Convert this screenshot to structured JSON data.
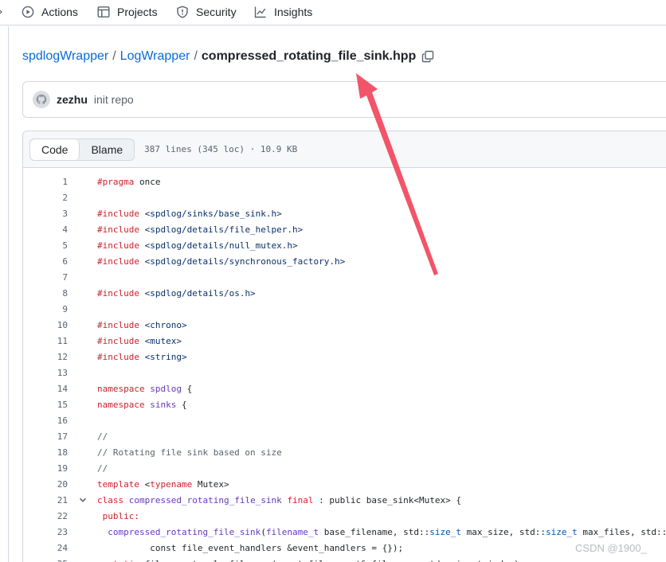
{
  "nav": {
    "items": [
      {
        "label": "Actions",
        "icon": "play-circle-icon"
      },
      {
        "label": "Projects",
        "icon": "table-icon"
      },
      {
        "label": "Security",
        "icon": "shield-icon"
      },
      {
        "label": "Insights",
        "icon": "graph-icon"
      }
    ]
  },
  "breadcrumb": {
    "repo": "spdlogWrapper",
    "folder": "LogWrapper",
    "separator": "/",
    "file": "compressed_rotating_file_sink.hpp"
  },
  "commit": {
    "author": "zezhu",
    "message": "init repo"
  },
  "file": {
    "tabs": [
      "Code",
      "Blame"
    ],
    "active_tab": "Code",
    "meta": "387 lines (345 loc) · 10.9 KB"
  },
  "code": {
    "lines": [
      {
        "n": "1",
        "tokens": [
          [
            "kw",
            "#pragma"
          ],
          [
            "pl",
            " once"
          ]
        ]
      },
      {
        "n": "2",
        "tokens": []
      },
      {
        "n": "3",
        "tokens": [
          [
            "kw",
            "#include"
          ],
          [
            "pl",
            " "
          ],
          [
            "str",
            "<spdlog/sinks/base_sink.h>"
          ]
        ]
      },
      {
        "n": "4",
        "tokens": [
          [
            "kw",
            "#include"
          ],
          [
            "pl",
            " "
          ],
          [
            "str",
            "<spdlog/details/file_helper.h>"
          ]
        ]
      },
      {
        "n": "5",
        "tokens": [
          [
            "kw",
            "#include"
          ],
          [
            "pl",
            " "
          ],
          [
            "str",
            "<spdlog/details/null_mutex.h>"
          ]
        ]
      },
      {
        "n": "6",
        "tokens": [
          [
            "kw",
            "#include"
          ],
          [
            "pl",
            " "
          ],
          [
            "str",
            "<spdlog/details/synchronous_factory.h>"
          ]
        ]
      },
      {
        "n": "7",
        "tokens": []
      },
      {
        "n": "8",
        "tokens": [
          [
            "kw",
            "#include"
          ],
          [
            "pl",
            " "
          ],
          [
            "str",
            "<spdlog/details/os.h>"
          ]
        ]
      },
      {
        "n": "9",
        "tokens": []
      },
      {
        "n": "10",
        "tokens": [
          [
            "kw",
            "#include"
          ],
          [
            "pl",
            " "
          ],
          [
            "str",
            "<chrono>"
          ]
        ]
      },
      {
        "n": "11",
        "tokens": [
          [
            "kw",
            "#include"
          ],
          [
            "pl",
            " "
          ],
          [
            "str",
            "<mutex>"
          ]
        ]
      },
      {
        "n": "12",
        "tokens": [
          [
            "kw",
            "#include"
          ],
          [
            "pl",
            " "
          ],
          [
            "str",
            "<string>"
          ]
        ]
      },
      {
        "n": "13",
        "tokens": []
      },
      {
        "n": "14",
        "tokens": [
          [
            "kw",
            "namespace"
          ],
          [
            "pl",
            " "
          ],
          [
            "ent",
            "spdlog"
          ],
          [
            "pl",
            " {"
          ]
        ]
      },
      {
        "n": "15",
        "tokens": [
          [
            "kw",
            "namespace"
          ],
          [
            "pl",
            " "
          ],
          [
            "ent",
            "sinks"
          ],
          [
            "pl",
            " {"
          ]
        ]
      },
      {
        "n": "16",
        "tokens": []
      },
      {
        "n": "17",
        "tokens": [
          [
            "com",
            "//"
          ]
        ]
      },
      {
        "n": "18",
        "tokens": [
          [
            "com",
            "// Rotating file sink based on size"
          ]
        ]
      },
      {
        "n": "19",
        "tokens": [
          [
            "com",
            "//"
          ]
        ]
      },
      {
        "n": "20",
        "tokens": [
          [
            "kw",
            "template"
          ],
          [
            "pl",
            " <"
          ],
          [
            "kw",
            "typename"
          ],
          [
            "pl",
            " Mutex>"
          ]
        ]
      },
      {
        "n": "21",
        "fold": true,
        "tokens": [
          [
            "kw",
            "class"
          ],
          [
            "pl",
            " "
          ],
          [
            "ent",
            "compressed_rotating_file_sink"
          ],
          [
            "pl",
            " "
          ],
          [
            "kw",
            "final"
          ],
          [
            "pl",
            " : public base_sink<Mutex> {"
          ]
        ]
      },
      {
        "n": "22",
        "tokens": [
          [
            "pl",
            " "
          ],
          [
            "kw",
            "public:"
          ]
        ]
      },
      {
        "n": "23",
        "tokens": [
          [
            "pl",
            "  "
          ],
          [
            "ent",
            "compressed_rotating_file_sink"
          ],
          [
            "pl",
            "("
          ],
          [
            "ent",
            "filename_t"
          ],
          [
            "pl",
            " base_filename, std::"
          ],
          [
            "type",
            "size_t"
          ],
          [
            "pl",
            " max_size, std::"
          ],
          [
            "type",
            "size_t"
          ],
          [
            "pl",
            " max_files, std::s"
          ]
        ]
      },
      {
        "n": "24",
        "tokens": [
          [
            "pl",
            "          const file_event_handlers &event_handlers = {});"
          ]
        ]
      },
      {
        "n": "25",
        "tokens": [
          [
            "pl",
            "  "
          ],
          [
            "kw",
            "static"
          ],
          [
            "pl",
            " filename_t calc_filename(const filename_t& filename, std::size_t index);"
          ]
        ]
      }
    ]
  },
  "watermark": "CSDN @1900_"
}
